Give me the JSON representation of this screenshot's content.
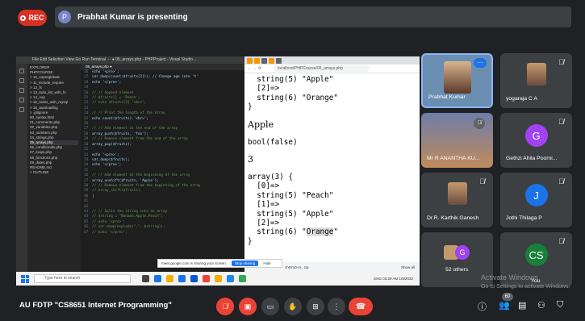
{
  "top": {
    "rec_label": "REC",
    "presenter_initial": "P",
    "presenting_text": "Prabhat Kumar is presenting"
  },
  "vscode": {
    "title": "File  Edit  Selection  View  Go  Run  Terminal  ···  ● 05_arrays.php - PHPProject - Visual Studio...",
    "tab": "05_arrays.php ●",
    "explorer": [
      "EXPLORER",
      "PHPCOURSE",
      "> 10_superglobals",
      "> 11_include_require",
      "> 12_fs",
      "> 13_todo_list_with_fs",
      "> 14_oop",
      "> 15_todos_with_mysql",
      "> 16_autoloading",
      "> .gitignore",
      "00_syntax.html",
      "01_comments.php",
      "02_variables.php",
      "03_numbers.php",
      "04_strings.php",
      "05_arrays.php",
      "06_conditionals.php",
      "07_loops.php",
      "08_functions.php",
      "09_dates.php",
      "README.md",
      "> OUTLINE"
    ],
    "lines": [
      {
        "n": "16",
        "t": "echo '<pre>';",
        "c": false
      },
      {
        "n": "17",
        "t": "var_dump(count($fruits[2])); // Change age into 't'",
        "c": false
      },
      {
        "n": "18",
        "t": "echo '</pre>';",
        "c": false
      },
      {
        "n": "19",
        "t": "",
        "c": false
      },
      {
        "n": "20",
        "t": "// // Append element",
        "c": true
      },
      {
        "n": "21",
        "t": "// $fruits[] = 'Peach';",
        "c": true
      },
      {
        "n": "22",
        "t": "// echo $fruits[3].'<br>';",
        "c": true
      },
      {
        "n": "23",
        "t": "",
        "c": false
      },
      {
        "n": "24",
        "t": "// // Print the length of the array",
        "c": true
      },
      {
        "n": "25",
        "t": "echo count($fruits).'<br>';",
        "c": false
      },
      {
        "n": "26",
        "t": "",
        "c": false
      },
      {
        "n": "27",
        "t": "// // Add element at the end of the array",
        "c": true
      },
      {
        "n": "28",
        "t": "array_push($fruits, 'foo');",
        "c": false
      },
      {
        "n": "29",
        "t": "// // Remove element from the end of the array",
        "c": true
      },
      {
        "n": "30",
        "t": "array_pop($fruits);",
        "c": false
      },
      {
        "n": "31",
        "t": "",
        "c": false
      },
      {
        "n": "32",
        "t": "echo '<pre>';",
        "c": false
      },
      {
        "n": "33",
        "t": "var_dump($fruits);",
        "c": false
      },
      {
        "n": "34",
        "t": "echo '</pre>';",
        "c": false
      },
      {
        "n": "35",
        "t": "",
        "c": false
      },
      {
        "n": "36",
        "t": "// // Add element at the beginning of the array",
        "c": true
      },
      {
        "n": "37",
        "t": "array_unshift($fruits, 'Apple');",
        "c": false
      },
      {
        "n": "38",
        "t": "// // Remove element from the beginning of the array",
        "c": true
      },
      {
        "n": "39",
        "t": "// array_shift($fruits);",
        "c": true
      },
      {
        "n": "40",
        "t": "|",
        "c": false
      },
      {
        "n": "41",
        "t": "",
        "c": false
      },
      {
        "n": "42",
        "t": "",
        "c": false
      },
      {
        "n": "43",
        "t": "// // Split the string into an array",
        "c": true
      },
      {
        "n": "44",
        "t": "// $string = \"Banana,Apple,Peach\";",
        "c": true
      },
      {
        "n": "45",
        "t": "// echo '<pre>';",
        "c": true
      },
      {
        "n": "46",
        "t": "// var_dump(explode(\",\", $string));",
        "c": true
      },
      {
        "n": "47",
        "t": "// echo '</pre>';",
        "c": true
      }
    ]
  },
  "browser": {
    "url": "localhost/PHPCourse/05_arrays.php",
    "out": {
      "l1": "  string(5) \"Apple\"",
      "l2": "  [2]=>",
      "l3": "  string(6) \"Orange\"",
      "l4": "}",
      "apple": "Apple",
      "bool": "bool(false)",
      "three": "3",
      "a1": "array(3) {",
      "a2": "  [0]=>",
      "a3": "  string(5) \"Peach\"",
      "a4": "  [1]=>",
      "a5": "  string(5) \"Apple\"",
      "a6": "  [2]=>",
      "a7": "  string(6) \"",
      "a7h": "Orange",
      "a7e": "\"",
      "a8": "}"
    },
    "download": "ch0210-m...zip",
    "show_all": "Show all"
  },
  "sharing": {
    "text": "meet.google.com is sharing your screen.",
    "stop": "Stop sharing",
    "hide": "Hide"
  },
  "taskbar": {
    "search": "Type here to search",
    "tray": "03:28 AM\n1/5/2022",
    "lang": "ENG"
  },
  "tiles": [
    {
      "name": "Prabhat Kumar"
    },
    {
      "name": "yogaraja C A"
    },
    {
      "name": "Mr R ANANTHA KU..."
    },
    {
      "name": "Gethzi Ahila Poorni...",
      "initial": "G"
    },
    {
      "name": "Dr.R. Karthik Ganesh"
    },
    {
      "name": "Jothi Thilaga P",
      "initial": "J"
    },
    {
      "name": "52 others",
      "initial": "G"
    },
    {
      "name": "You",
      "initial": "CS"
    }
  ],
  "activate": {
    "title": "Activate Windows",
    "sub": "Go to Settings to activate Windows."
  },
  "bottom": {
    "meeting": "AU FDTP \"CS8651 Internet Programming\"",
    "badge": "60"
  },
  "colors": {
    "rec": "#d93025",
    "end": "#ea4335",
    "green": "#188038",
    "blue": "#1a73e8",
    "purple": "#a142f4"
  }
}
